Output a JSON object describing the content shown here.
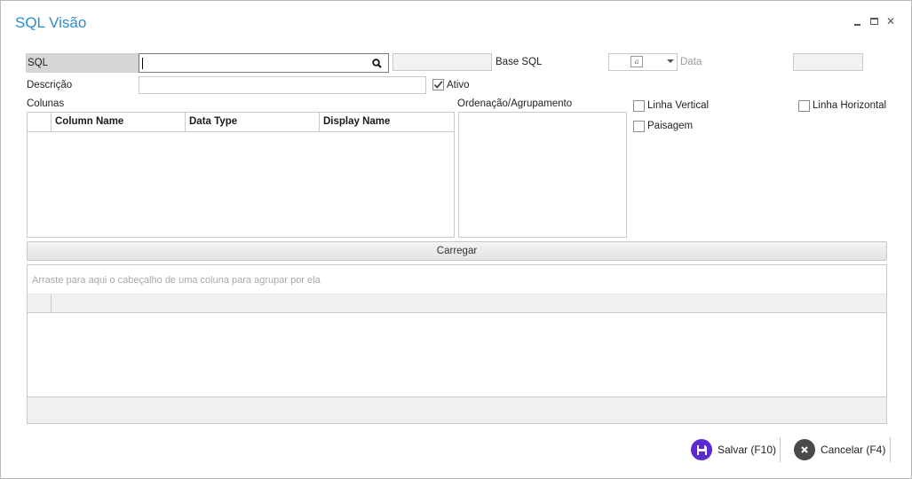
{
  "window": {
    "title": "SQL Visão",
    "controls": {
      "minimize": "‗",
      "maximize": "☐",
      "close": "✕"
    }
  },
  "form": {
    "sql_label": "SQL",
    "sql_value": "",
    "base_sql_label": "Base SQL",
    "data_label": "Data",
    "descricao_label": "Descrição",
    "descricao_value": "",
    "ativo_label": "Ativo",
    "ativo_checked": true,
    "colunas_label": "Colunas",
    "ordenacao_label": "Ordenação/Agrupamento",
    "linha_vertical_label": "Linha Vertical",
    "linha_horizontal_label": "Linha Horizontal",
    "paisagem_label": "Paisagem",
    "data_type_icon": "a"
  },
  "columns_grid": {
    "headers": [
      "Column Name",
      "Data Type",
      "Display Name"
    ],
    "rows": []
  },
  "carregar_label": "Carregar",
  "result_grid": {
    "group_hint": "Arraste para aqui o cabeçalho de uma coluna para agrupar por ela"
  },
  "footer": {
    "save_label": "Salvar (F10)",
    "cancel_label": "Cancelar (F4)"
  },
  "colors": {
    "title": "#2a8bd2",
    "save_icon": "#5b2bd1",
    "cancel_icon": "#4a4a4a"
  }
}
